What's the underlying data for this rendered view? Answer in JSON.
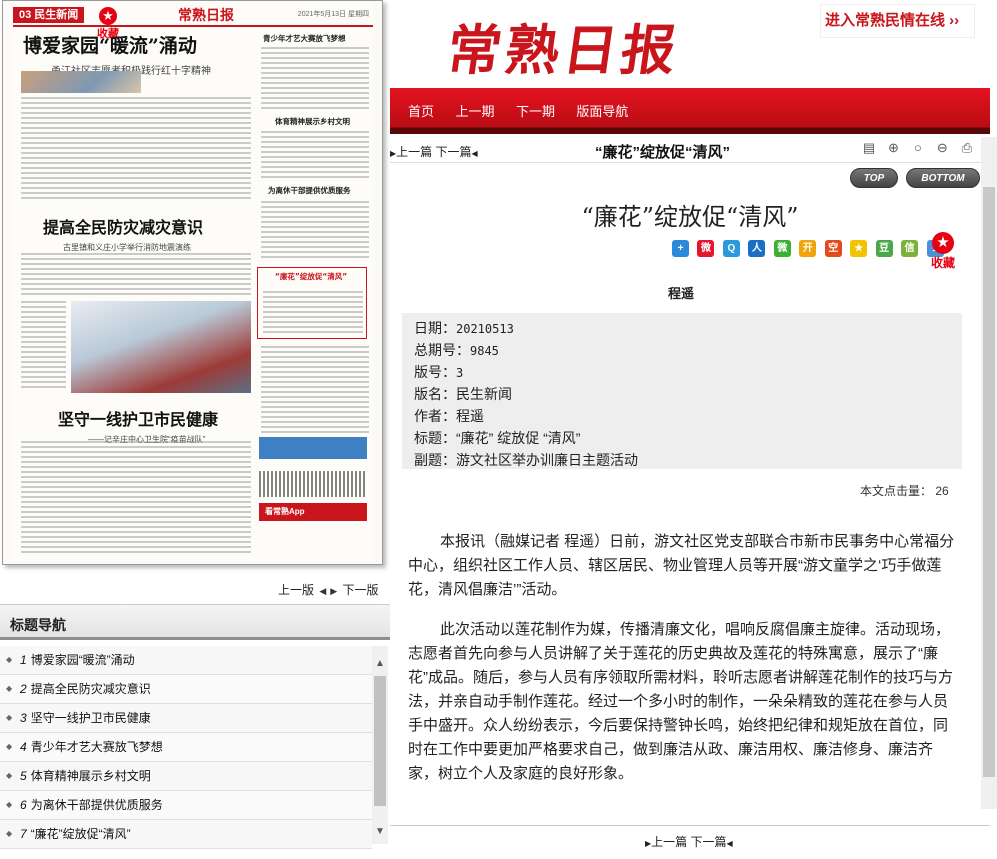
{
  "paper_thumbnail": {
    "section": "03 民生新闻",
    "logo": "常熟日报",
    "date": "2021年5月13日 星期四",
    "favorite": "收藏",
    "headline1": "博爱家园“暖流”涌动",
    "sub1": "甬江社区志愿者积极践行红十字精神",
    "headline2": "提高全民防灾减灾意识",
    "sub2": "古里镇和义庄小学举行消防地震演练",
    "headline3": "坚守一线护卫市民健康",
    "sub3": "——记辛庄中心卫生院“疫苗战队”",
    "side_headlines": [
      "青少年才艺大赛放飞梦想",
      "体育精神展示乡村文明",
      "为离休干部提供优质服务",
      "“廉花”绽放促“清风”"
    ],
    "app_banner": "看常熟App"
  },
  "left_pager": {
    "prev": "上一版",
    "next": "下一版"
  },
  "title_nav": {
    "heading": "标题导航",
    "items": [
      {
        "num": "1",
        "title": "博爱家园“暖流”涌动"
      },
      {
        "num": "2",
        "title": "提高全民防灾减灾意识"
      },
      {
        "num": "3",
        "title": "坚守一线护卫市民健康"
      },
      {
        "num": "4",
        "title": "青少年才艺大赛放飞梦想"
      },
      {
        "num": "5",
        "title": "体育精神展示乡村文明"
      },
      {
        "num": "6",
        "title": "为离休干部提供优质服务"
      },
      {
        "num": "7",
        "title": "“廉花”绽放促“清风”"
      }
    ]
  },
  "masthead": {
    "logo": "常熟日报",
    "enter_link": "进入常熟民情在线 ››"
  },
  "top_nav": [
    "首页",
    "上一期",
    "下一期",
    "版面导航"
  ],
  "toolbar": {
    "prev": "上一篇",
    "next": "下一篇",
    "title": "“廉花”绽放促“清风”",
    "top_label": "TOP",
    "bottom_label": "BOTTOM"
  },
  "article": {
    "title": "“廉花”绽放促“清风”",
    "author": "程遥",
    "favorite": "收藏",
    "meta": [
      {
        "key": "日期",
        "value": "20210513"
      },
      {
        "key": "总期号",
        "value": "9845"
      },
      {
        "key": "版号",
        "value": "3"
      },
      {
        "key": "版名",
        "value": "民生新闻"
      },
      {
        "key": "作者",
        "value": "程遥"
      },
      {
        "key": "标题",
        "value": "“廉花” 绽放促 “清风”"
      },
      {
        "key": "副题",
        "value": "游文社区举办训廉日主题活动"
      }
    ],
    "clicks_label": "本文点击量：",
    "clicks": "26",
    "paragraphs": [
      "本报讯（融媒记者 程遥）日前，游文社区党支部联合市新市民事务中心常福分中心，组织社区工作人员、辖区居民、物业管理人员等开展“游文童学之‘巧手做莲花，清风倡廉洁’”活动。",
      "此次活动以莲花制作为媒，传播清廉文化，唱响反腐倡廉主旋律。活动现场，志愿者首先向参与人员讲解了关于莲花的历史典故及莲花的特殊寓意，展示了“廉花”成品。随后，参与人员有序领取所需材料，聆听志愿者讲解莲花制作的技巧与方法，并亲自动手制作莲花。经过一个多小时的制作，一朵朵精致的莲花在参与人员手中盛开。众人纷纷表示，今后要保持警钟长鸣，始终把纪律和规矩放在首位，同时在工作中要更加严格要求自己，做到廉洁从政、廉洁用权、廉洁修身、廉洁齐家，树立个人及家庭的良好形象。"
    ]
  },
  "bottom_pager": {
    "prev": "上一篇",
    "next": "下一篇"
  },
  "colors": {
    "brand_red": "#c9161d",
    "dark_red": "#58070b",
    "meta_bg": "#eeeeee"
  }
}
